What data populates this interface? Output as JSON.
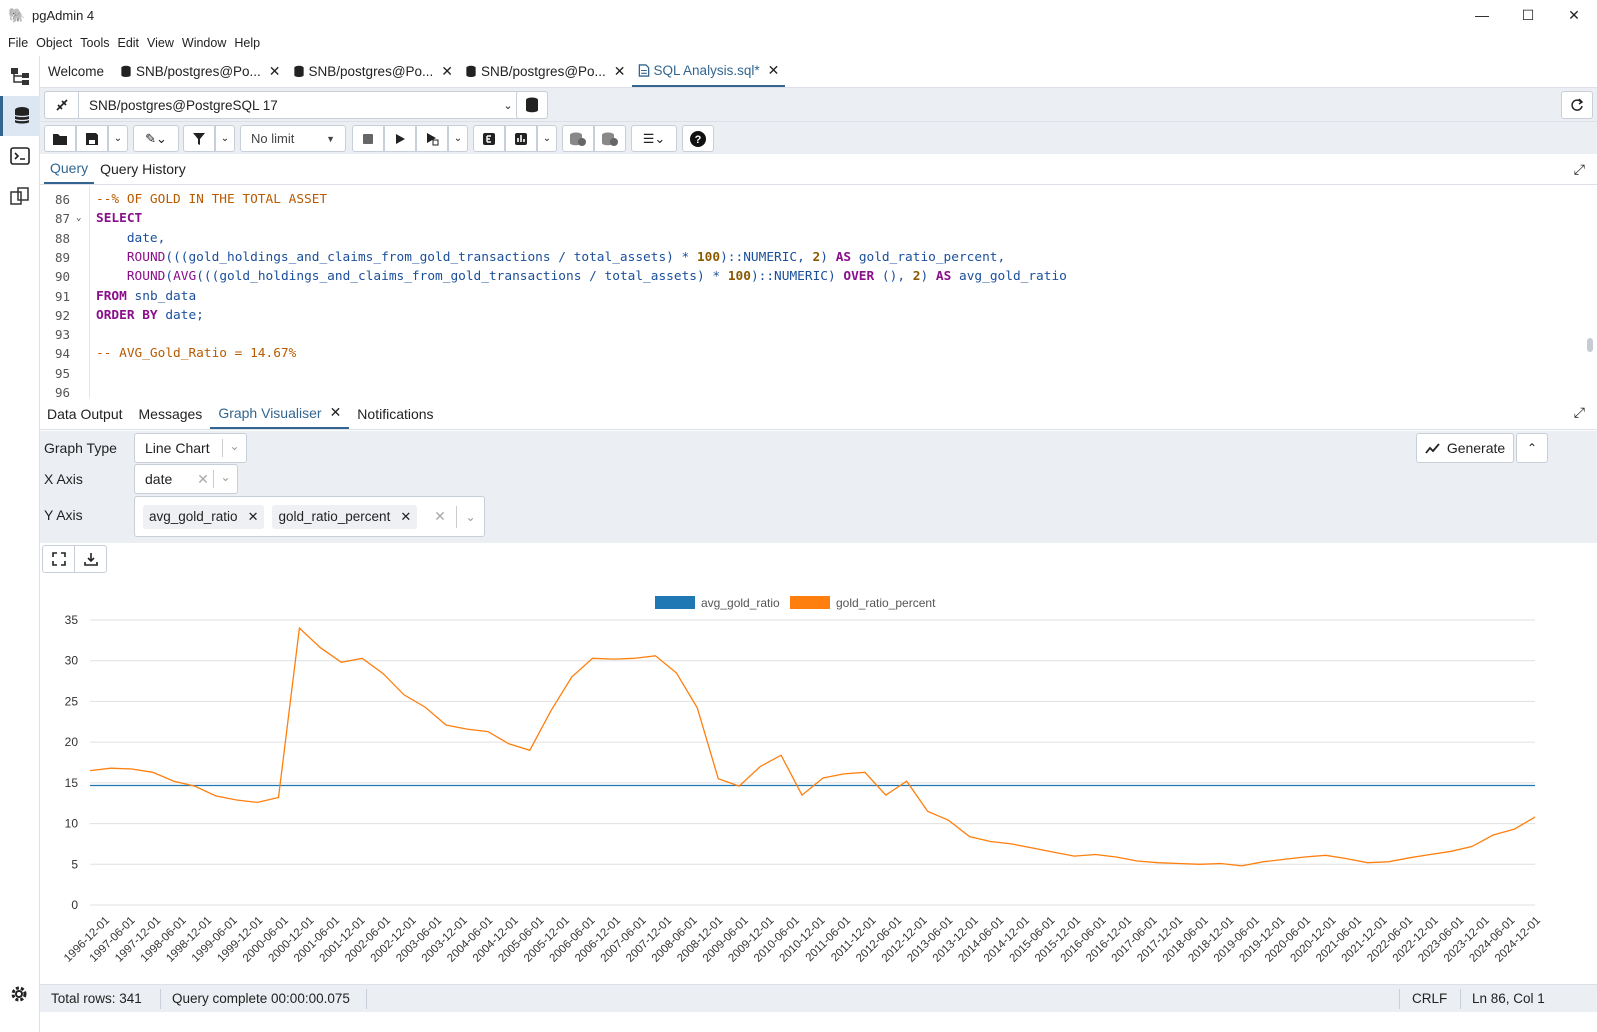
{
  "window": {
    "title": "pgAdmin 4"
  },
  "menu": [
    "File",
    "Object",
    "Tools",
    "Edit",
    "View",
    "Window",
    "Help"
  ],
  "tabs": [
    {
      "label": "Welcome"
    },
    {
      "label": "SNB/postgres@Po..."
    },
    {
      "label": "SNB/postgres@Po..."
    },
    {
      "label": "SNB/postgres@Po..."
    },
    {
      "label": "SQL Analysis.sql*"
    }
  ],
  "connection": {
    "label": "SNB/postgres@PostgreSQL 17"
  },
  "toolbar": {
    "limit_label": "No limit"
  },
  "query_tabs": [
    "Query",
    "Query History"
  ],
  "editor": {
    "line_numbers": [
      "86",
      "87",
      "88",
      "89",
      "90",
      "91",
      "92",
      "93",
      "94",
      "95",
      "96"
    ],
    "lines": [
      [
        {
          "t": "--% OF GOLD IN THE TOTAL ASSET",
          "c": "cm"
        }
      ],
      [
        {
          "t": "SELECT",
          "c": "kw"
        }
      ],
      [
        {
          "t": "    date,",
          "c": "id"
        }
      ],
      [
        {
          "t": "    ",
          "c": "plain"
        },
        {
          "t": "ROUND",
          "c": "fn"
        },
        {
          "t": "(((gold_holdings_and_claims_from_gold_transactions / total_assets) * ",
          "c": "id"
        },
        {
          "t": "100",
          "c": "num"
        },
        {
          "t": ")::NUMERIC, ",
          "c": "id"
        },
        {
          "t": "2",
          "c": "num"
        },
        {
          "t": ") ",
          "c": "id"
        },
        {
          "t": "AS",
          "c": "kw"
        },
        {
          "t": " gold_ratio_percent,",
          "c": "id"
        }
      ],
      [
        {
          "t": "    ",
          "c": "plain"
        },
        {
          "t": "ROUND",
          "c": "fn"
        },
        {
          "t": "(",
          "c": "id"
        },
        {
          "t": "AVG",
          "c": "fn"
        },
        {
          "t": "(((gold_holdings_and_claims_from_gold_transactions / total_assets) * ",
          "c": "id"
        },
        {
          "t": "100",
          "c": "num"
        },
        {
          "t": ")::NUMERIC) ",
          "c": "id"
        },
        {
          "t": "OVER",
          "c": "kw"
        },
        {
          "t": " (), ",
          "c": "id"
        },
        {
          "t": "2",
          "c": "num"
        },
        {
          "t": ") ",
          "c": "id"
        },
        {
          "t": "AS",
          "c": "kw"
        },
        {
          "t": " avg_gold_ratio",
          "c": "id"
        }
      ],
      [
        {
          "t": "FROM",
          "c": "kw"
        },
        {
          "t": " snb_data",
          "c": "id"
        }
      ],
      [
        {
          "t": "ORDER BY",
          "c": "kw"
        },
        {
          "t": " date;",
          "c": "id"
        }
      ],
      [
        {
          "t": "",
          "c": "plain"
        }
      ],
      [
        {
          "t": "-- AVG_Gold_Ratio = 14.67%",
          "c": "cm"
        }
      ],
      [
        {
          "t": "",
          "c": "plain"
        }
      ],
      [
        {
          "t": "",
          "c": "plain"
        }
      ]
    ]
  },
  "result_tabs": [
    "Data Output",
    "Messages",
    "Graph Visualiser",
    "Notifications"
  ],
  "graph": {
    "type_label": "Graph Type",
    "type_value": "Line Chart",
    "x_label": "X Axis",
    "x_value": "date",
    "y_label": "Y Axis",
    "y_values": [
      "avg_gold_ratio",
      "gold_ratio_percent"
    ],
    "generate_label": "Generate"
  },
  "chart_data": {
    "type": "line",
    "x_ticks": [
      "1996-12-01",
      "1997-06-01",
      "1997-12-01",
      "1998-06-01",
      "1998-12-01",
      "1999-06-01",
      "1999-12-01",
      "2000-06-01",
      "2000-12-01",
      "2001-06-01",
      "2001-12-01",
      "2002-06-01",
      "2002-12-01",
      "2003-06-01",
      "2003-12-01",
      "2004-06-01",
      "2004-12-01",
      "2005-06-01",
      "2005-12-01",
      "2006-06-01",
      "2006-12-01",
      "2007-06-01",
      "2007-12-01",
      "2008-06-01",
      "2008-12-01",
      "2009-06-01",
      "2009-12-01",
      "2010-06-01",
      "2010-12-01",
      "2011-06-01",
      "2011-12-01",
      "2012-06-01",
      "2012-12-01",
      "2013-06-01",
      "2013-12-01",
      "2014-06-01",
      "2014-12-01",
      "2015-06-01",
      "2015-12-01",
      "2016-06-01",
      "2016-12-01",
      "2017-06-01",
      "2017-12-01",
      "2018-06-01",
      "2018-12-01",
      "2019-06-01",
      "2019-12-01",
      "2020-06-01",
      "2020-12-01",
      "2021-06-01",
      "2021-12-01",
      "2022-06-01",
      "2022-12-01",
      "2023-06-01",
      "2023-12-01",
      "2024-06-01",
      "2024-12-01"
    ],
    "ylim": [
      0,
      35
    ],
    "y_ticks": [
      0,
      5,
      10,
      15,
      20,
      25,
      30,
      35
    ],
    "grid": true,
    "legend": "top-center",
    "series": [
      {
        "name": "avg_gold_ratio",
        "color": "#1f77b4",
        "values": [
          14.67,
          14.67
        ]
      },
      {
        "name": "gold_ratio_percent",
        "color": "#ff7f0e",
        "values": [
          16.5,
          16.8,
          16.7,
          16.3,
          15.2,
          14.6,
          13.4,
          12.9,
          12.6,
          13.2,
          34.0,
          31.6,
          29.8,
          30.3,
          28.4,
          25.8,
          24.3,
          22.1,
          21.6,
          21.3,
          19.8,
          19.0,
          23.8,
          28.0,
          30.3,
          30.2,
          30.3,
          30.6,
          28.5,
          24.2,
          15.5,
          14.6,
          17.0,
          18.4,
          13.5,
          15.6,
          16.1,
          16.3,
          13.5,
          15.2,
          11.5,
          10.4,
          8.4,
          7.8,
          7.5,
          7.0,
          6.5,
          6.0,
          6.2,
          5.9,
          5.4,
          5.2,
          5.1,
          5.0,
          5.1,
          4.8,
          5.3,
          5.6,
          5.9,
          6.1,
          5.7,
          5.2,
          5.3,
          5.8,
          6.2,
          6.6,
          7.2,
          8.6,
          9.3,
          10.8
        ]
      }
    ]
  },
  "status": {
    "rows": "Total rows: 341",
    "query": "Query complete 00:00:00.075",
    "eol": "CRLF",
    "pos": "Ln 86, Col 1"
  }
}
